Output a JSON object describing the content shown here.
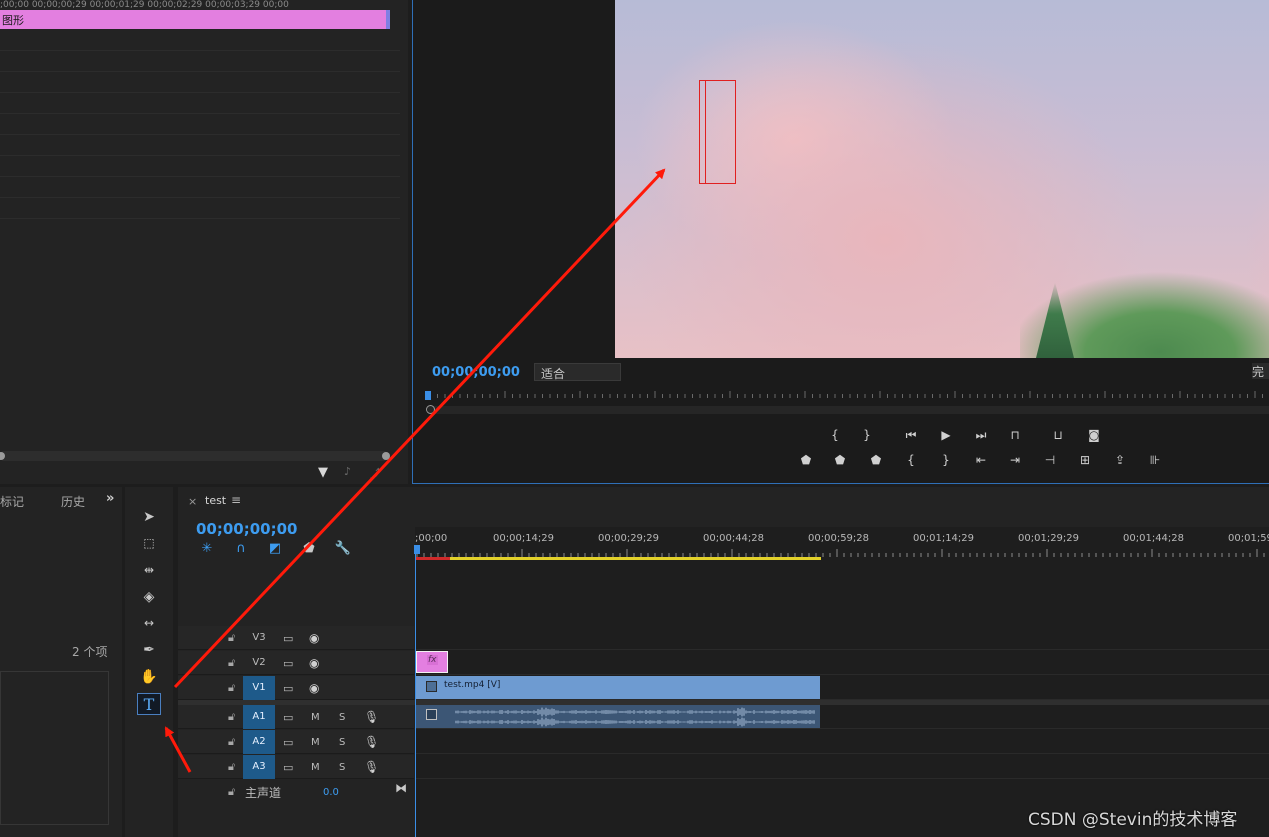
{
  "effect_controls": {
    "ruler_text": ";00;00    00;00;00;29    00;00;01;29    00;00;02;29    00;00;03;29    00;00",
    "clip_label": "图形"
  },
  "program_monitor": {
    "timecode": "00;00;00;00",
    "fit_select": "适合",
    "resolution_partial": "完",
    "controls_row1": [
      "{",
      "}",
      "⏮",
      "▶",
      "⏭"
    ],
    "playhead_fraction": 0
  },
  "markers_history": {
    "tab_markers": "标记",
    "tab_history": "历史",
    "more": "»",
    "item_count": "2 个项"
  },
  "timeline": {
    "sequence_name": "test",
    "close": "×",
    "menu": "≡",
    "timecode": "00;00;00;00",
    "ruler_labels": [
      ";00;00",
      "00;00;14;29",
      "00;00;29;29",
      "00;00;44;28",
      "00;00;59;28",
      "00;01;14;29",
      "00;01;29;29",
      "00;01;44;28",
      "00;01;59"
    ],
    "tracks": {
      "v3": "V3",
      "v2": "V2",
      "v1": "V1",
      "a1": "A1",
      "a2": "A2",
      "a3": "A3",
      "m": "M",
      "s": "S"
    },
    "clip_fx_label": "fx",
    "clip_v1_label": "test.mp4 [V]",
    "master_label": "主声道",
    "master_value": "0.0"
  },
  "watermark": "CSDN @Stevin的技术博客",
  "colors": {
    "accent_blue": "#3d9cf0",
    "graphic_clip": "#e37fe0",
    "video_clip": "#6e9bd1",
    "audio_clip": "#3c5675",
    "annotation_red": "#ff1a0a"
  }
}
